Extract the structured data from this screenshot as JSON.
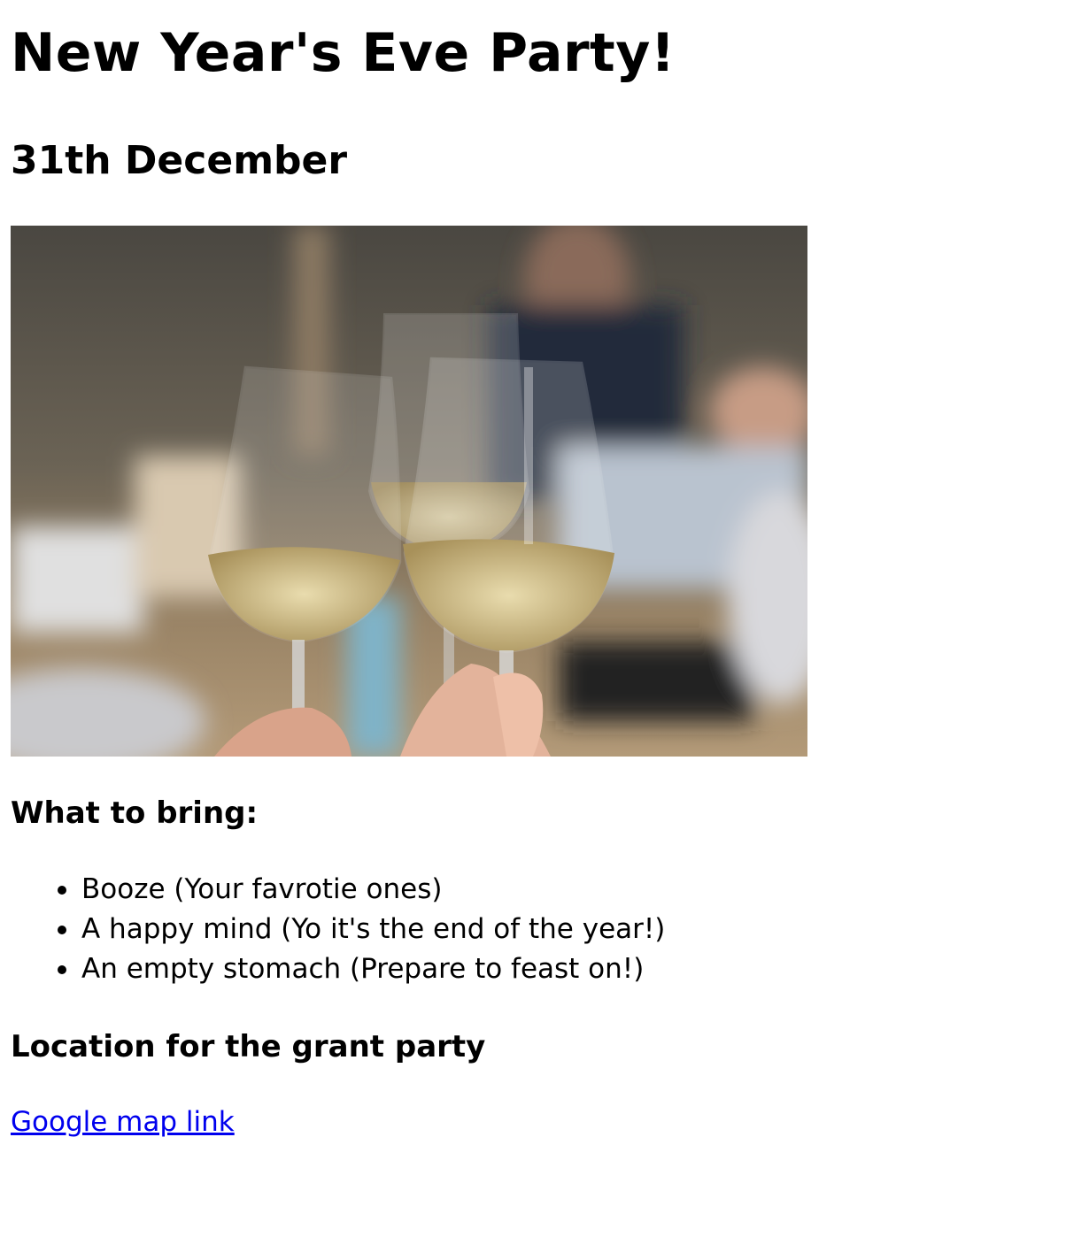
{
  "page": {
    "title": "New Year's Eve Party!",
    "date": "31th December",
    "photo": {
      "alt": "Three wine glasses clinking in a toast",
      "icon": "wine-glasses-photo"
    },
    "bring": {
      "heading": "What to bring:",
      "items": [
        "Booze (Your favrotie ones)",
        "A happy mind (Yo it's the end of the year!)",
        "An empty stomach (Prepare to feast on!)"
      ]
    },
    "location": {
      "heading": "Location for the grant party",
      "link_text": "Google map link"
    },
    "colors": {
      "text": "#000000",
      "link": "#0000ee",
      "background": "#ffffff"
    }
  }
}
